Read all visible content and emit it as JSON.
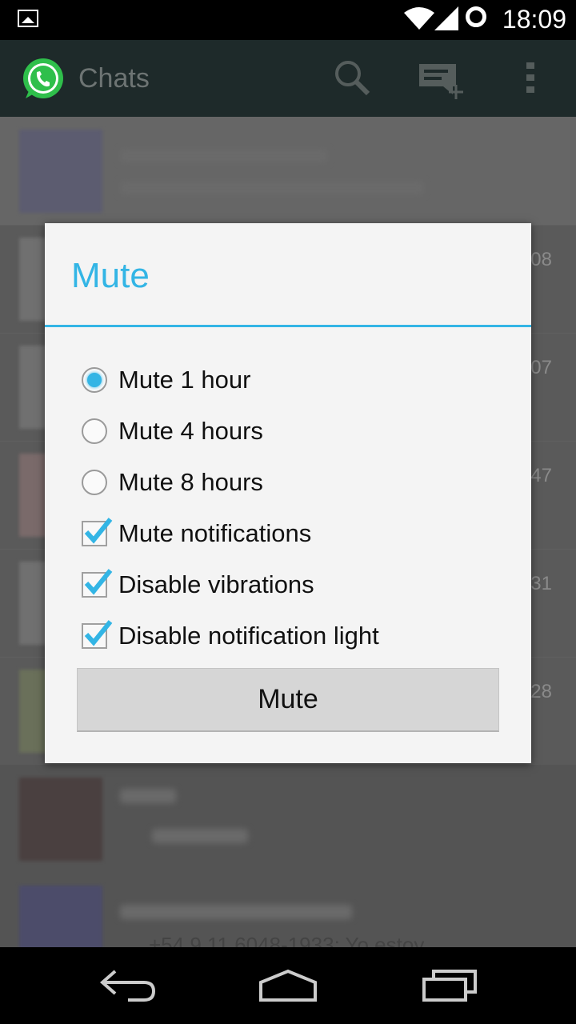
{
  "status_bar": {
    "time": "18:09"
  },
  "action_bar": {
    "title": "Chats"
  },
  "chat_list": {
    "times": [
      "08",
      "07",
      "47",
      "31",
      "28"
    ],
    "preview_text": "+54 9 11 6048-1933: Yo estoy"
  },
  "dialog": {
    "title": "Mute",
    "radio_options": [
      {
        "label": "Mute 1 hour",
        "checked": true
      },
      {
        "label": "Mute 4 hours",
        "checked": false
      },
      {
        "label": "Mute 8 hours",
        "checked": false
      }
    ],
    "checkbox_options": [
      {
        "label": "Mute notifications",
        "checked": true
      },
      {
        "label": "Disable vibrations",
        "checked": true
      },
      {
        "label": "Disable notification light",
        "checked": true
      }
    ],
    "button_label": "Mute"
  },
  "colors": {
    "accent": "#33b5e5",
    "action_bar": "#1e2a2a",
    "whatsapp_green": "#2fbf4b"
  },
  "icons": [
    "gallery-icon",
    "wifi-icon",
    "signal-icon",
    "sync-icon",
    "whatsapp-logo-icon",
    "search-icon",
    "new-chat-icon",
    "overflow-menu-icon",
    "back-icon",
    "home-icon",
    "recents-icon"
  ]
}
